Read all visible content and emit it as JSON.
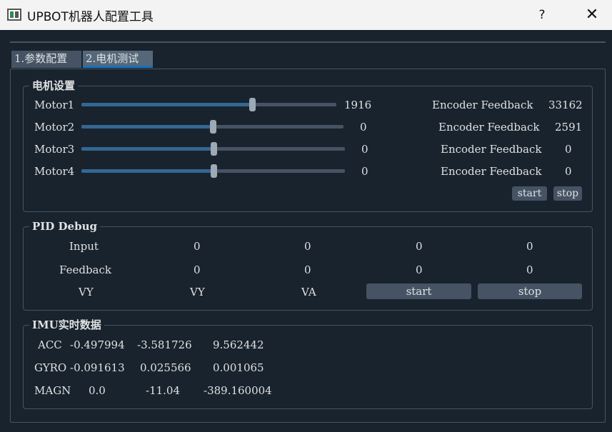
{
  "window": {
    "title": "UPBOT机器人配置工具",
    "help_label": "?",
    "close_label": "✕"
  },
  "tabs": [
    {
      "label": "1.参数配置",
      "active": false
    },
    {
      "label": "2.电机测试",
      "active": true
    }
  ],
  "motor_group": {
    "title": "电机设置",
    "encoder_label": "Encoder Feedback",
    "motors": [
      {
        "name": "Motor1",
        "value": "1916",
        "level": 0.67,
        "feedback": "33162"
      },
      {
        "name": "Motor2",
        "value": "0",
        "level": 0.5,
        "feedback": "2591"
      },
      {
        "name": "Motor3",
        "value": "0",
        "level": 0.5,
        "feedback": "0"
      },
      {
        "name": "Motor4",
        "value": "0",
        "level": 0.5,
        "feedback": "0"
      }
    ],
    "start_label": "start",
    "stop_label": "stop"
  },
  "pid_group": {
    "title": "PID Debug",
    "input_label": "Input",
    "input_values": [
      "0",
      "0",
      "0",
      "0"
    ],
    "feedback_label": "Feedback",
    "feedback_values": [
      "0",
      "0",
      "0",
      "0"
    ],
    "vy_label": "VY",
    "col_vy": "VY",
    "col_va": "VA",
    "start_label": "start",
    "stop_label": "stop"
  },
  "imu_group": {
    "title": "IMU实时数据",
    "rows": [
      {
        "label": "ACC",
        "x": "-0.497994",
        "y": "-3.581726",
        "z": "9.562442"
      },
      {
        "label": "GYRO",
        "x": "-0.091613",
        "y": "0.025566",
        "z": "0.001065"
      },
      {
        "label": "MAGN",
        "x": "0.0",
        "y": "-11.04",
        "z": "-389.160004"
      }
    ]
  },
  "colors": {
    "background": "#19232d",
    "panel_border": "#455364",
    "accent": "#1a72bb",
    "slider_fill": "#346792",
    "text": "#dfe1e2"
  }
}
